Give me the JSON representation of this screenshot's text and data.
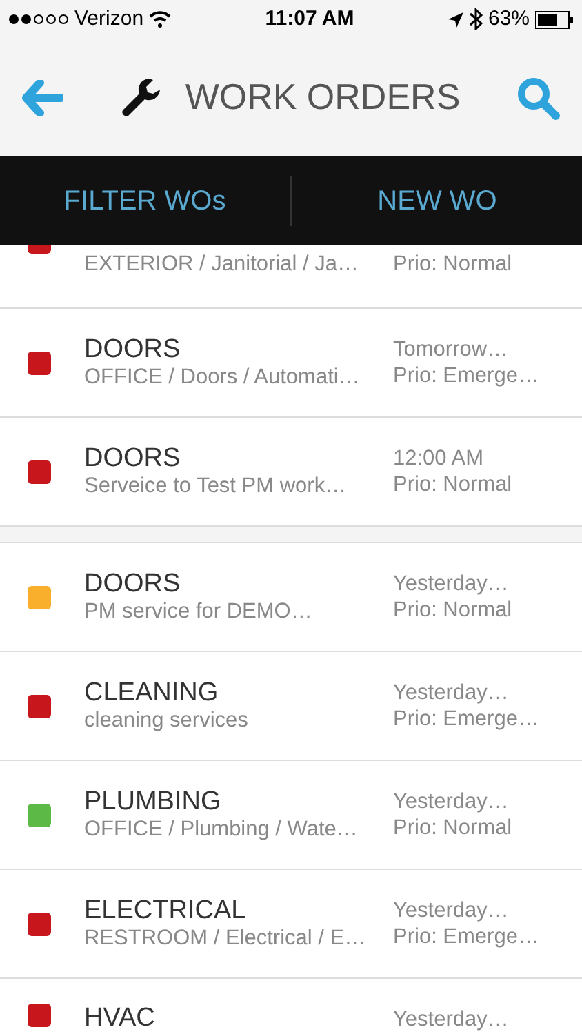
{
  "status_bar": {
    "carrier": "Verizon",
    "time": "11:07 AM",
    "battery": "63%"
  },
  "header": {
    "title": "WORK ORDERS"
  },
  "tabs": [
    {
      "label": "FILTER WOs"
    },
    {
      "label": "NEW WO"
    }
  ],
  "groups": [
    [
      {
        "kind": "partial",
        "subtitle": "EXTERIOR / Janitorial / Ja…",
        "prio": "Prio: Normal",
        "color": "#c8161d"
      },
      {
        "kind": "full",
        "title": "DOORS",
        "subtitle": "OFFICE / Doors / Automati…",
        "date": "Tomorrow…",
        "prio": "Prio: Emerge…",
        "color": "#c8161d"
      },
      {
        "kind": "full",
        "title": "DOORS",
        "subtitle": "Serveice to Test PM work…",
        "date": "12:00 AM",
        "prio": "Prio: Normal",
        "color": "#c8161d"
      }
    ],
    [
      {
        "kind": "full",
        "title": "DOORS",
        "subtitle": "PM service for DEMO…",
        "date": "Yesterday…",
        "prio": "Prio: Normal",
        "color": "#f9ae2c"
      },
      {
        "kind": "full",
        "title": "CLEANING",
        "subtitle": "cleaning services",
        "date": "Yesterday…",
        "prio": "Prio: Emerge…",
        "color": "#c8161d"
      },
      {
        "kind": "full",
        "title": "PLUMBING",
        "subtitle": "OFFICE / Plumbing / Wate…",
        "date": "Yesterday…",
        "prio": "Prio: Normal",
        "color": "#5cb946"
      },
      {
        "kind": "full",
        "title": "ELECTRICAL",
        "subtitle": "RESTROOM / Electrical / E…",
        "date": "Yesterday…",
        "prio": "Prio: Emerge…",
        "color": "#c8161d"
      },
      {
        "kind": "cut",
        "title": "HVAC",
        "date": "Yesterday…",
        "color": "#c8161d"
      }
    ]
  ]
}
